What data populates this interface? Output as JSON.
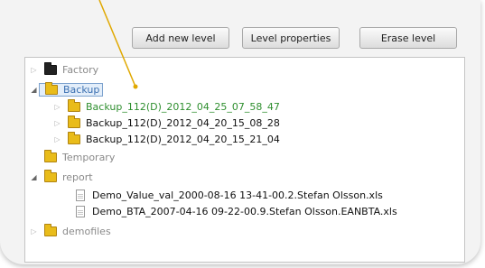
{
  "toolbar": {
    "add_label": "Add new level",
    "properties_label": "Level properties",
    "erase_label": "Erase level"
  },
  "tree": {
    "factory": "Factory",
    "backup": "Backup",
    "backup_children": [
      "Backup_112(D)_2012_04_25_07_58_47",
      "Backup_112(D)_2012_04_20_15_08_28",
      "Backup_112(D)_2012_04_20_15_21_04"
    ],
    "temporary": "Temporary",
    "report": "report",
    "report_files": [
      "Demo_Value_val_2000-08-16 13-41-00.2.Stefan Olsson.xls",
      "Demo_BTA_2007-04-16 09-22-00.9.Stefan Olsson.EANBTA.xls"
    ],
    "demofiles": "demofiles"
  },
  "colors": {
    "accent_green": "#2f8f2f",
    "selection_border": "#7da2ce",
    "pointer_line": "#e0a800"
  }
}
